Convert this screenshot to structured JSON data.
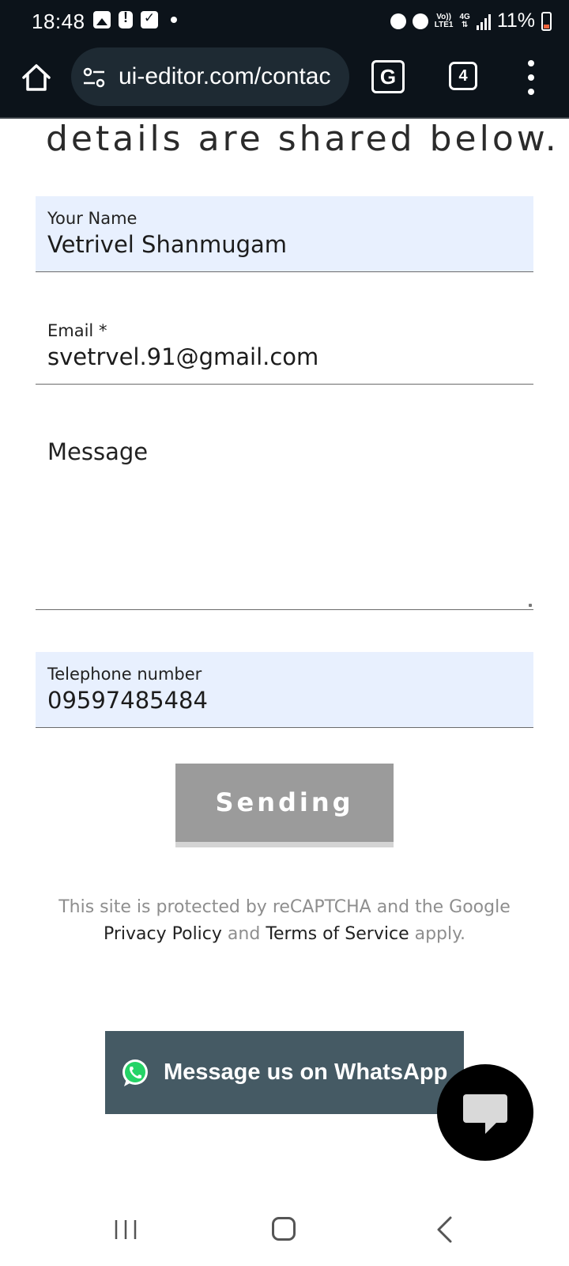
{
  "status_bar": {
    "time": "18:48",
    "network_top": "Vo))",
    "network_bottom": "LTE1",
    "net_type": "4G",
    "battery": "11%"
  },
  "browser": {
    "url": "ui-editor.com/contac",
    "tab_count": "4",
    "translate_glyph": "G"
  },
  "page": {
    "heading_fragment": "details are shared below.",
    "form": {
      "name": {
        "label": "Your Name",
        "value": "Vetrivel Shanmugam"
      },
      "email": {
        "label": "Email *",
        "value": "svetrvel.91@gmail.com"
      },
      "message": {
        "label": "Message",
        "value": ""
      },
      "phone": {
        "label": "Telephone number",
        "value": "09597485484"
      },
      "submit_label": "Sending"
    },
    "recaptcha": {
      "line1": "This site is protected by reCAPTCHA and the Google",
      "privacy": "Privacy Policy",
      "and": "and",
      "terms": "Terms of Service",
      "apply": "apply."
    },
    "whatsapp": {
      "label": "Message us on WhatsApp",
      "icon": "whatsapp-icon"
    },
    "chat_fab": {
      "icon": "chat-bubble-icon"
    }
  },
  "colors": {
    "status_bg": "#0c131a",
    "field_autofill": "#e8f0fe",
    "button_disabled": "#9b9b9b",
    "whatsapp_bar": "#455a64",
    "whatsapp_green": "#25d366"
  }
}
